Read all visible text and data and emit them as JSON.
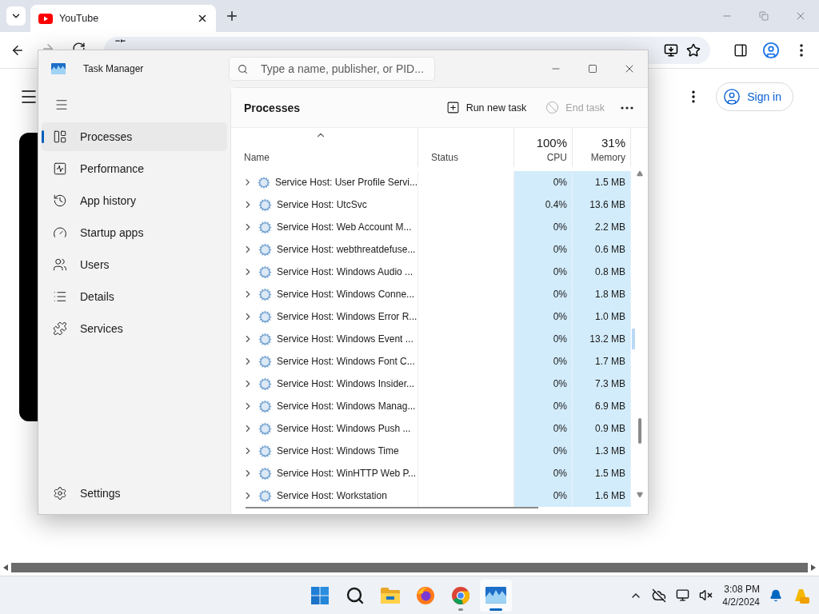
{
  "browser": {
    "tabs": [
      {
        "title": "YouTube",
        "selected": true
      }
    ],
    "sign_in": "Sign in"
  },
  "task_manager": {
    "title": "Task Manager",
    "search_placeholder": "Type a name, publisher, or PID...",
    "nav": [
      {
        "label": "Processes",
        "kind": "processes",
        "selected": true
      },
      {
        "label": "Performance",
        "kind": "performance",
        "selected": false
      },
      {
        "label": "App history",
        "kind": "history",
        "selected": false
      },
      {
        "label": "Startup apps",
        "kind": "startup",
        "selected": false
      },
      {
        "label": "Users",
        "kind": "users",
        "selected": false
      },
      {
        "label": "Details",
        "kind": "details",
        "selected": false
      },
      {
        "label": "Services",
        "kind": "services",
        "selected": false
      }
    ],
    "settings": "Settings",
    "page_title": "Processes",
    "actions": [
      {
        "label": "Run new task",
        "kind": "run",
        "disabled": false
      },
      {
        "label": "End task",
        "kind": "end",
        "disabled": true
      }
    ],
    "columns": [
      {
        "label": "Name"
      },
      {
        "label": "Status"
      },
      {
        "label": "CPU",
        "total": "100%"
      },
      {
        "label": "Memory",
        "total": "31%"
      }
    ],
    "rows": [
      {
        "name": "Service Host: User Profile Servi...",
        "cpu": "0%",
        "memory": "1.5 MB"
      },
      {
        "name": "Service Host: UtcSvc",
        "cpu": "0.4%",
        "memory": "13.6 MB"
      },
      {
        "name": "Service Host: Web Account M...",
        "cpu": "0%",
        "memory": "2.2 MB"
      },
      {
        "name": "Service Host: webthreatdefuse...",
        "cpu": "0%",
        "memory": "0.6 MB"
      },
      {
        "name": "Service Host: Windows Audio ...",
        "cpu": "0%",
        "memory": "0.8 MB"
      },
      {
        "name": "Service Host: Windows Conne...",
        "cpu": "0%",
        "memory": "1.8 MB"
      },
      {
        "name": "Service Host: Windows Error R...",
        "cpu": "0%",
        "memory": "1.0 MB"
      },
      {
        "name": "Service Host: Windows Event ...",
        "cpu": "0%",
        "memory": "13.2 MB"
      },
      {
        "name": "Service Host: Windows Font C...",
        "cpu": "0%",
        "memory": "1.7 MB"
      },
      {
        "name": "Service Host: Windows Insider...",
        "cpu": "0%",
        "memory": "7.3 MB"
      },
      {
        "name": "Service Host: Windows Manag...",
        "cpu": "0%",
        "memory": "6.9 MB"
      },
      {
        "name": "Service Host: Windows Push ...",
        "cpu": "0%",
        "memory": "0.9 MB"
      },
      {
        "name": "Service Host: Windows Time",
        "cpu": "0%",
        "memory": "1.3 MB"
      },
      {
        "name": "Service Host: WinHTTP Web P...",
        "cpu": "0%",
        "memory": "1.5 MB"
      },
      {
        "name": "Service Host: Workstation",
        "cpu": "0%",
        "memory": "1.6 MB"
      }
    ]
  },
  "taskbar": {
    "apps": [
      {
        "kind": "start",
        "running": false,
        "selected": false
      },
      {
        "kind": "search",
        "running": false,
        "selected": false
      },
      {
        "kind": "files",
        "running": false,
        "selected": false
      },
      {
        "kind": "firefox",
        "running": false,
        "selected": false
      },
      {
        "kind": "chrome",
        "running": true,
        "selected": false
      },
      {
        "kind": "taskmgr",
        "running": true,
        "selected": true
      }
    ],
    "time": "3:08 PM",
    "date": "4/2/2024"
  }
}
